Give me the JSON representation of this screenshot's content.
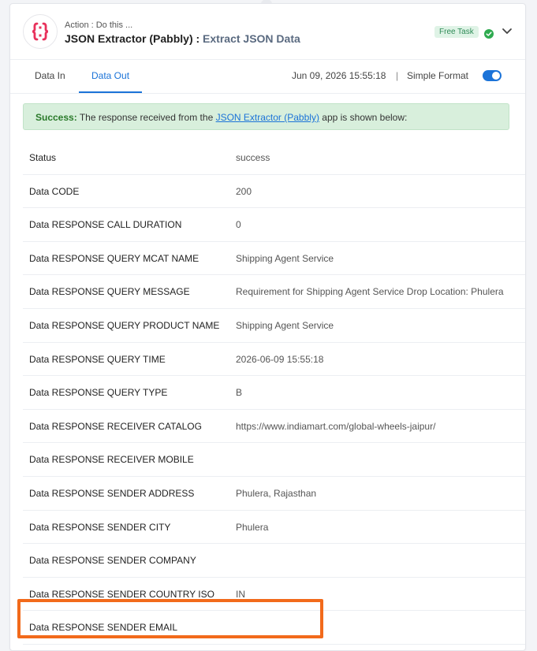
{
  "header": {
    "action_label": "Action : Do this ...",
    "app_name": "JSON Extractor (Pabbly) :",
    "event_name": "Extract JSON Data",
    "badge": "Free Task"
  },
  "tabs": [
    {
      "label": "Data In"
    },
    {
      "label": "Data Out"
    }
  ],
  "toolbar": {
    "timestamp": "Jun 09, 2026 15:55:18",
    "separator": "|",
    "format_label": "Simple Format",
    "simple_format_on": true
  },
  "success": {
    "prefix": "Success:",
    "text_before": " The response received from the ",
    "link": "JSON Extractor (Pabbly)",
    "text_after": " app is shown below:"
  },
  "rows": [
    {
      "key": "Status",
      "value": "success"
    },
    {
      "key": "Data CODE",
      "value": "200"
    },
    {
      "key": "Data RESPONSE CALL DURATION",
      "value": "0"
    },
    {
      "key": "Data RESPONSE QUERY MCAT NAME",
      "value": "Shipping Agent Service"
    },
    {
      "key": "Data RESPONSE QUERY MESSAGE",
      "value": "Requirement for Shipping Agent Service Drop Location: Phulera"
    },
    {
      "key": "Data RESPONSE QUERY PRODUCT NAME",
      "value": "Shipping Agent Service"
    },
    {
      "key": "Data RESPONSE QUERY TIME",
      "value": "2026-06-09 15:55:18"
    },
    {
      "key": "Data RESPONSE QUERY TYPE",
      "value": "B"
    },
    {
      "key": "Data RESPONSE RECEIVER CATALOG",
      "value": "https://www.indiamart.com/global-wheels-jaipur/"
    },
    {
      "key": "Data RESPONSE RECEIVER MOBILE",
      "value": ""
    },
    {
      "key": "Data RESPONSE SENDER ADDRESS",
      "value": "Phulera, Rajasthan"
    },
    {
      "key": "Data RESPONSE SENDER CITY",
      "value": "Phulera"
    },
    {
      "key": "Data RESPONSE SENDER COMPANY",
      "value": ""
    },
    {
      "key": "Data RESPONSE SENDER COUNTRY ISO",
      "value": "IN"
    },
    {
      "key": "Data RESPONSE SENDER EMAIL",
      "value": ""
    }
  ],
  "colors": {
    "accent": "#1b73d8",
    "success_bg": "#d8efdc",
    "highlight": "#f26a1b",
    "app_icon": "#e8315b"
  }
}
